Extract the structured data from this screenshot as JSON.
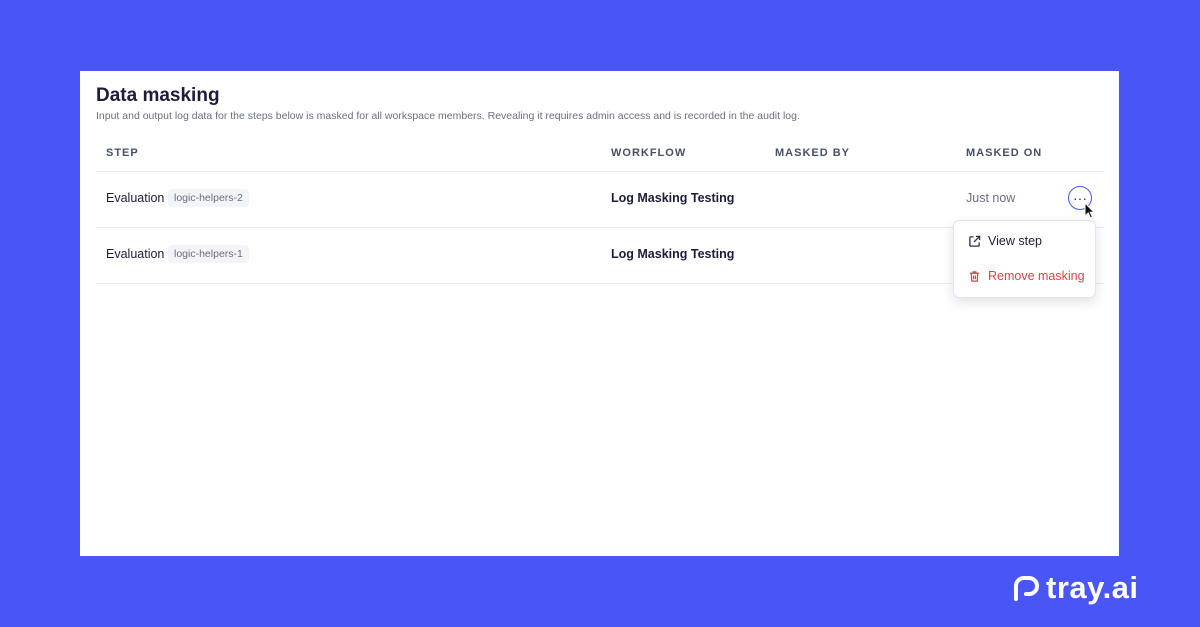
{
  "page": {
    "title": "Data masking",
    "description": "Input and output log data for the steps below is masked for all workspace members. Revealing it requires admin access and is recorded in the audit log."
  },
  "table": {
    "headers": {
      "step": "STEP",
      "workflow": "WORKFLOW",
      "masked_by": "MASKED BY",
      "masked_on": "MASKED ON"
    },
    "rows": [
      {
        "step": "Evaluation",
        "tag": "logic-helpers-2",
        "workflow": "Log Masking Testing",
        "masked_by": "",
        "masked_on": "Just now"
      },
      {
        "step": "Evaluation",
        "tag": "logic-helpers-1",
        "workflow": "Log Masking Testing",
        "masked_by": "",
        "masked_on": ""
      }
    ]
  },
  "menu": {
    "items": [
      {
        "label": "View step",
        "icon": "external-link-icon"
      },
      {
        "label": "Remove masking",
        "icon": "trash-icon"
      }
    ]
  },
  "more_button": {
    "glyph": "···"
  },
  "brand": {
    "name": "tray.ai"
  },
  "colors": {
    "background": "#4a55f5",
    "accent": "#4a55f5",
    "danger": "#d64545"
  }
}
